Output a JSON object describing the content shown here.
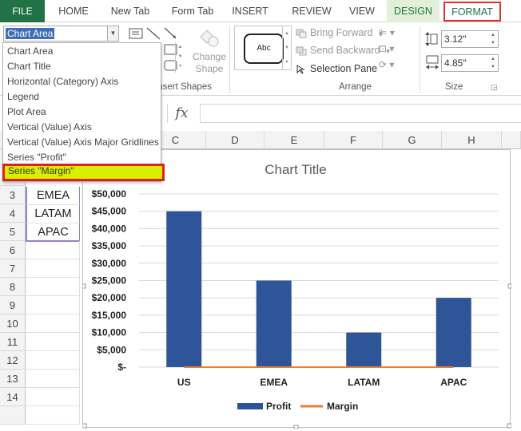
{
  "ribbon_tabs": [
    "FILE",
    "HOME",
    "New Tab",
    "Form Tab",
    "INSERT",
    "REVIEW",
    "VIEW",
    "DESIGN",
    "FORMAT"
  ],
  "ribbon": {
    "selection_value": "Chart Area",
    "change_shape_label": "Change Shape",
    "insert_shapes_group": "Insert Shapes",
    "style_preview_label": "Abc",
    "bring_forward": "Bring Forward",
    "send_backward": "Send Backward",
    "selection_pane": "Selection Pane",
    "arrange_group": "Arrange",
    "shape_height": "3.12\"",
    "shape_width": "4.85\"",
    "size_group": "Size"
  },
  "formula_bar": {
    "fx_label": "fx",
    "value": ""
  },
  "dropdown_items": [
    "Chart Area",
    "Chart Title",
    "Horizontal (Category) Axis",
    "Legend",
    "Plot Area",
    "Vertical (Value) Axis",
    "Vertical (Value) Axis Major Gridlines",
    "Series \"Profit\"",
    "Series \"Margin\""
  ],
  "grid": {
    "columns": [
      "C",
      "D",
      "E",
      "F",
      "G",
      "H"
    ],
    "rows": [
      "3",
      "4",
      "5",
      "6",
      "7",
      "8",
      "9",
      "10",
      "11",
      "12",
      "13",
      "14"
    ],
    "cells_col_b": [
      "EMEA",
      "LATAM",
      "APAC"
    ]
  },
  "chart_data": {
    "type": "bar",
    "title": "Chart Title",
    "categories": [
      "US",
      "EMEA",
      "LATAM",
      "APAC"
    ],
    "series": [
      {
        "name": "Profit",
        "type": "bar",
        "values": [
          45000,
          25000,
          10000,
          20000
        ],
        "color": "#2e5597"
      },
      {
        "name": "Margin",
        "type": "line",
        "values": [
          0,
          0,
          0,
          0
        ],
        "color": "#ed7d31"
      }
    ],
    "y_ticks": [
      "$-",
      "$5,000",
      "$10,000",
      "$15,000",
      "$20,000",
      "$25,000",
      "$30,000",
      "$35,000",
      "$40,000",
      "$45,000",
      "$50,000"
    ],
    "ylim": [
      0,
      50000
    ],
    "grid": true,
    "legend_position": "bottom"
  }
}
